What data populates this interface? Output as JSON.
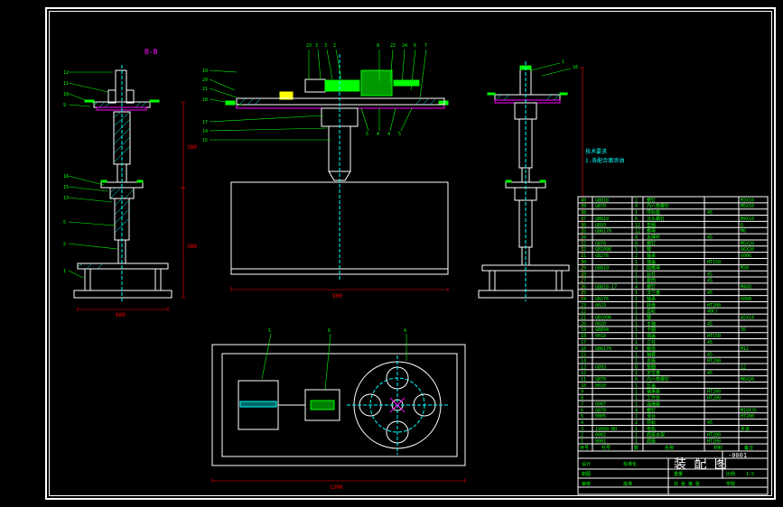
{
  "drawing": {
    "number": "-0001",
    "title": "装 配 图",
    "section_label": "B-B",
    "dims": {
      "width_mid": "900",
      "width_left": "680",
      "width_bottom": "1200",
      "height": "380",
      "height2": "380"
    },
    "note_right": "技术要求\n1.各配合面涂油"
  },
  "balloons_left": [
    "12",
    "11",
    "10",
    "9",
    "16",
    "15",
    "13",
    "5",
    "2",
    "1"
  ],
  "balloons_mid_top": [
    "23",
    "3",
    "3",
    "2",
    "8",
    "22",
    "24",
    "6",
    "7"
  ],
  "balloons_mid_left": [
    "19",
    "20",
    "21",
    "18",
    "17",
    "14",
    "15"
  ],
  "balloons_mid_bot": [
    "5",
    "4",
    "4",
    "5"
  ],
  "balloons_right": [
    "1",
    "16"
  ],
  "balloons_bottom": [
    "5",
    "6",
    "4"
  ],
  "bom_header": [
    "序号",
    "代号",
    "数",
    "名称",
    "材料",
    "备注"
  ],
  "bom": [
    {
      "n": "40",
      "c": "GB818",
      "q": "2",
      "name": "螺钉",
      "mat": "",
      "rem": "M3X10"
    },
    {
      "n": "39",
      "c": "GB70",
      "q": "4",
      "name": "内六角螺钉",
      "mat": "",
      "rem": "M5X16"
    },
    {
      "n": "38",
      "c": "",
      "q": "1",
      "name": "导轨座",
      "mat": "45",
      "rem": ""
    },
    {
      "n": "37",
      "c": "GB819",
      "q": "6",
      "name": "沉头螺钉",
      "mat": "",
      "rem": "M4X10"
    },
    {
      "n": "36",
      "c": "GB93",
      "q": "12",
      "name": "垫圈",
      "mat": "",
      "rem": "6"
    },
    {
      "n": "35",
      "c": "GB6170",
      "q": "12",
      "name": "螺母",
      "mat": "",
      "rem": "M6"
    },
    {
      "n": "34",
      "c": "",
      "q": "4",
      "name": "支撑杆",
      "mat": "45",
      "rem": ""
    },
    {
      "n": "33",
      "c": "GB70",
      "q": "8",
      "name": "螺钉",
      "mat": "",
      "rem": "M5X20"
    },
    {
      "n": "32",
      "c": "GB1096",
      "q": "1",
      "name": "键",
      "mat": "",
      "rem": "A6X20"
    },
    {
      "n": "31",
      "c": "GB276",
      "q": "2",
      "name": "轴承",
      "mat": "",
      "rem": "6006"
    },
    {
      "n": "30",
      "c": "",
      "q": "1",
      "name": "端盖",
      "mat": "HT150",
      "rem": ""
    },
    {
      "n": "29",
      "c": "GB810",
      "q": "2",
      "name": "圆螺母",
      "mat": "",
      "rem": "M30"
    },
    {
      "n": "28",
      "c": "",
      "q": "1",
      "name": "丝杠",
      "mat": "45",
      "rem": ""
    },
    {
      "n": "27",
      "c": "",
      "q": "1",
      "name": "套筒",
      "mat": "45",
      "rem": ""
    },
    {
      "n": "26",
      "c": "GB818-17",
      "q": "4",
      "name": "螺钉",
      "mat": "",
      "rem": "M4X8"
    },
    {
      "n": "25",
      "c": "",
      "q": "1",
      "name": "法兰盘",
      "mat": "45",
      "rem": ""
    },
    {
      "n": "24",
      "c": "GB276",
      "q": "1",
      "name": "轴承",
      "mat": "",
      "rem": "6008"
    },
    {
      "n": "23",
      "c": "0023",
      "q": "1",
      "name": "转盘",
      "mat": "HT200",
      "rem": ""
    },
    {
      "n": "22",
      "c": "",
      "q": "1",
      "name": "齿轮",
      "mat": "40Cr",
      "rem": ""
    },
    {
      "n": "21",
      "c": "GB1096",
      "q": "1",
      "name": "键",
      "mat": "",
      "rem": "A5X14"
    },
    {
      "n": "20",
      "c": "0020",
      "q": "1",
      "name": "主轴",
      "mat": "45",
      "rem": ""
    },
    {
      "n": "19",
      "c": "GB894",
      "q": "1",
      "name": "卡圈",
      "mat": "",
      "rem": "35"
    },
    {
      "n": "18",
      "c": "0018",
      "q": "1",
      "name": "端盖",
      "mat": "HT150",
      "rem": ""
    },
    {
      "n": "17",
      "c": "",
      "q": "1",
      "name": "立柱",
      "mat": "45",
      "rem": ""
    },
    {
      "n": "16",
      "c": "GB6170",
      "q": "4",
      "name": "螺母",
      "mat": "",
      "rem": "M12"
    },
    {
      "n": "15",
      "c": "",
      "q": "1",
      "name": "轴套",
      "mat": "45",
      "rem": ""
    },
    {
      "n": "14",
      "c": "",
      "q": "1",
      "name": "支座",
      "mat": "HT200",
      "rem": ""
    },
    {
      "n": "13",
      "c": "GB93",
      "q": "8",
      "name": "垫圈",
      "mat": "",
      "rem": "12"
    },
    {
      "n": "12",
      "c": "",
      "q": "1",
      "name": "定位盘",
      "mat": "45",
      "rem": ""
    },
    {
      "n": "11",
      "c": "GB70",
      "q": "6",
      "name": "内六角螺钉",
      "mat": "",
      "rem": "M6X20"
    },
    {
      "n": "10",
      "c": "0010",
      "q": "1",
      "name": "压盖",
      "mat": "",
      "rem": ""
    },
    {
      "n": "9",
      "c": "",
      "q": "1",
      "name": "轴承座",
      "mat": "HT200",
      "rem": ""
    },
    {
      "n": "8",
      "c": "",
      "q": "1",
      "name": "工作台",
      "mat": "HT200",
      "rem": ""
    },
    {
      "n": "7",
      "c": "0007",
      "q": "1",
      "name": "连接座",
      "mat": "",
      "rem": ""
    },
    {
      "n": "6",
      "c": "GB70",
      "q": "4",
      "name": "螺钉",
      "mat": "",
      "rem": "M10X35"
    },
    {
      "n": "5",
      "c": "0005",
      "q": "1",
      "name": "滑台",
      "mat": "",
      "rem": "HT200"
    },
    {
      "n": "4",
      "c": "",
      "q": "2",
      "name": "导轨",
      "mat": "45",
      "rem": ""
    },
    {
      "n": "3",
      "c": "19999-NO",
      "q": "1",
      "name": "电机",
      "mat": "",
      "rem": "步进"
    },
    {
      "n": "2",
      "c": "0002",
      "q": "1",
      "name": "底座支架",
      "mat": "HT200",
      "rem": ""
    },
    {
      "n": "1",
      "c": "0001",
      "q": "1",
      "name": "底座",
      "mat": "HT200",
      "rem": ""
    }
  ],
  "title_block": {
    "scale_label": "比例",
    "scale": "1:5",
    "sheet_label": "共 张 第 张",
    "mass_label": "重量",
    "design_label": "设计",
    "check_label": "审核",
    "draw_label": "制图",
    "standard_label": "标准化",
    "approve_label": "批准",
    "material_label": "材料",
    "company": "学院"
  }
}
